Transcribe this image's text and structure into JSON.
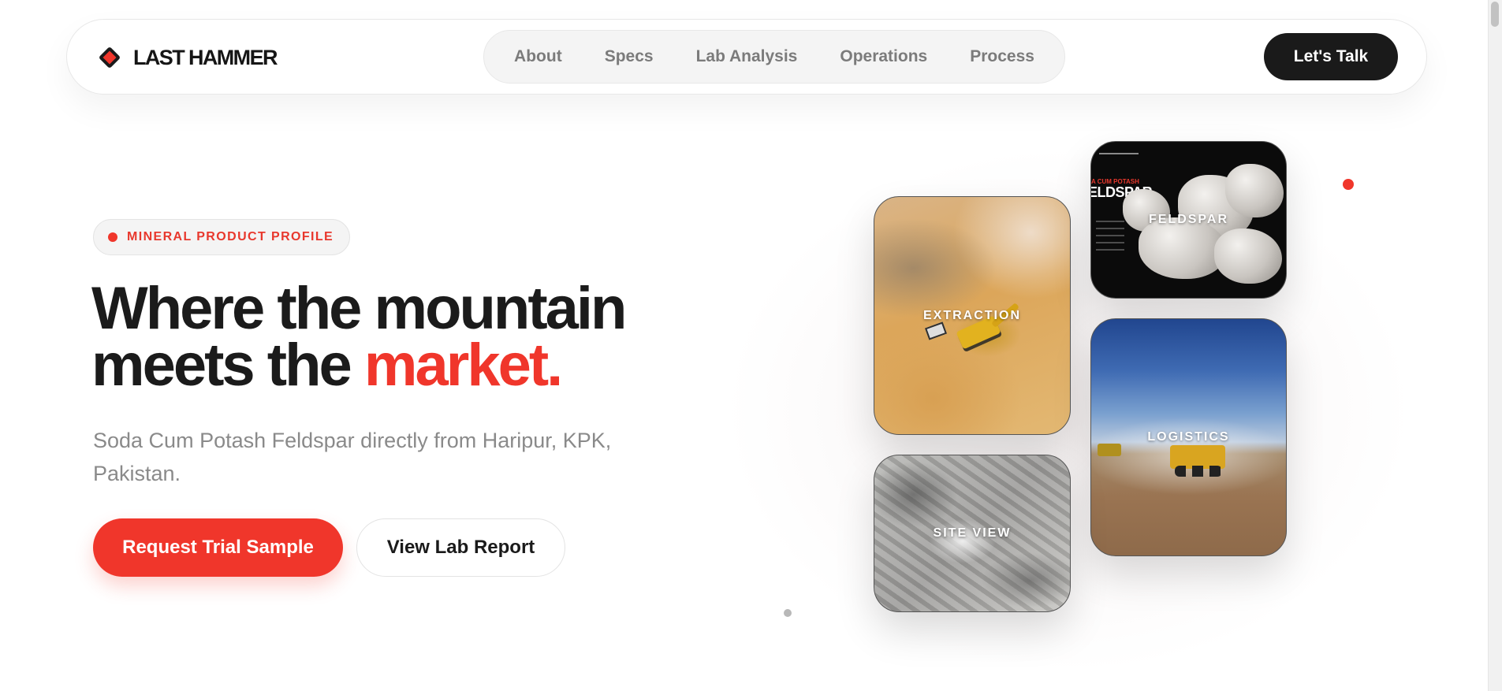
{
  "brand": {
    "name": "LAST HAMMER"
  },
  "nav": {
    "links": [
      "About",
      "Specs",
      "Lab Analysis",
      "Operations",
      "Process"
    ],
    "cta": "Let's Talk"
  },
  "hero": {
    "badge": "MINERAL PRODUCT PROFILE",
    "headline_line1": "Where the mountain",
    "headline_line2_prefix": "meets the ",
    "headline_accent": "market.",
    "subtext": "Soda Cum Potash Feldspar directly from Haripur, KPK, Pakistan.",
    "primary_button": "Request Trial Sample",
    "secondary_button": "View Lab Report"
  },
  "gallery": {
    "extraction": "EXTRACTION",
    "feldspar": "FELDSPAR",
    "logistics": "LOGISTICS",
    "site_view": "SITE VIEW",
    "feldspar_poster": {
      "kicker": "A CUM POTASH",
      "title": "ELDSPAR"
    }
  },
  "colors": {
    "accent": "#f0362b",
    "dark": "#1a1a1a",
    "muted": "#8a8a8a"
  }
}
